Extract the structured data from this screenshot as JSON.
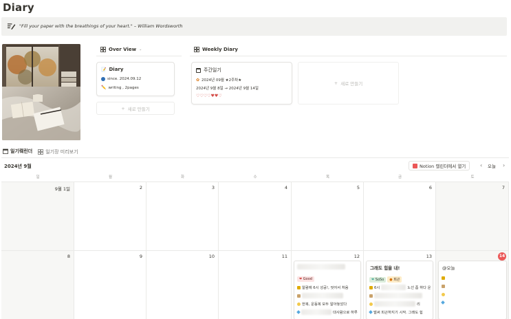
{
  "page": {
    "title": "Diary",
    "quote": "\"Fill your paper with the breathings of your heart.\" – William Wordsworth"
  },
  "overview": {
    "tab_label": "Over View",
    "card": {
      "title": "Diary",
      "since": "since. 2024.09.12",
      "info": "writing , 2pages"
    },
    "new_label": "새로 만들기"
  },
  "weekly": {
    "tab_label": "Weekly Diary",
    "card": {
      "title": "주간일기",
      "week": "2024년 09월 ★2주차★",
      "range": "2024년 9월 8일 → 2024년 9월 14일",
      "hearts": "♡♡♡♡♥♥♡"
    },
    "new_label": "새로 만들기"
  },
  "views": {
    "tabs": [
      {
        "label": "일기캨린더",
        "active": true
      },
      {
        "label": "일기장 미리보기",
        "active": false
      }
    ]
  },
  "calendar": {
    "month_label": "2024년 9월",
    "open_in_notion": "Notion 캘린더에서 열기",
    "prev": "‹",
    "today_label": "오늘",
    "next": "›",
    "weekdays": [
      "일",
      "월",
      "화",
      "수",
      "목",
      "금",
      "토"
    ],
    "days": [
      "9월 1일",
      "2",
      "3",
      "4",
      "5",
      "6",
      "7",
      "8",
      "9",
      "10",
      "11",
      "12",
      "13",
      "14"
    ],
    "today_marker": "14",
    "events": {
      "thu": {
        "tag": "Good",
        "line1": "알람에 6시 성공!, 씻어서 처음",
        "line3": "한복, 운동복 모두 알아놓았다",
        "line4": "대사람으로 하루"
      },
      "fri": {
        "title": "그래도 힘을 내!",
        "tag1": "SoSo",
        "tag2": "피곤",
        "line1a": "6시",
        "line1b": "노선 좀 하다 운",
        "line3": "리",
        "line4": "벌써 피곤하지기 시작. 그래도 힘"
      },
      "sat": {
        "title": "@오늘"
      }
    }
  },
  "colors": {
    "today_badge": "#eb5757",
    "good_tag_bg": "#fbe4e4",
    "soso_tag_bg": "#dbeddb",
    "tired_tag_bg": "#fdecc8"
  }
}
